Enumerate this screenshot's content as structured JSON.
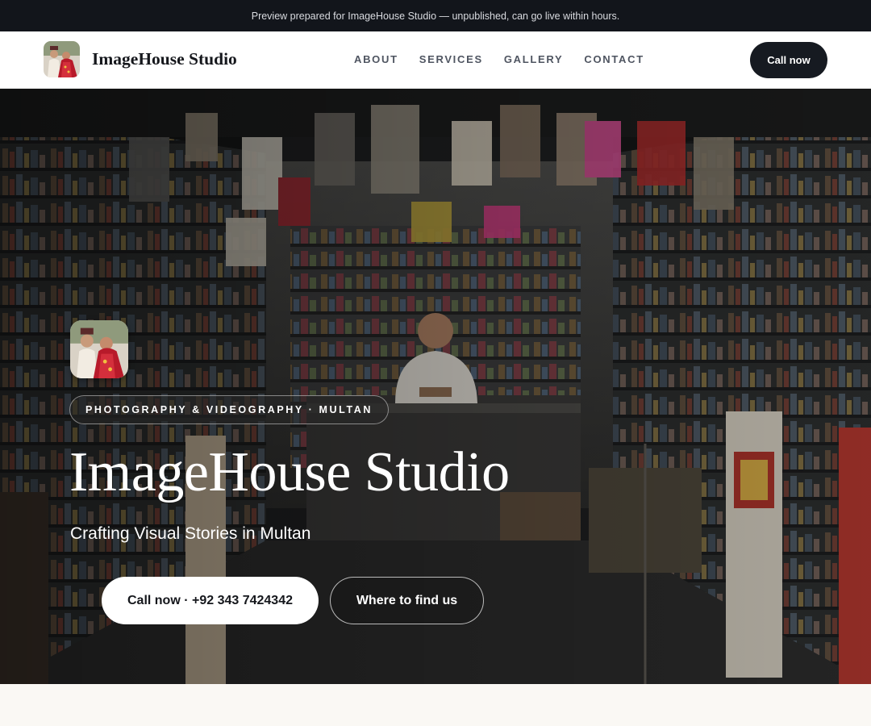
{
  "banner": {
    "text": "Preview prepared for ImageHouse Studio — unpublished, can go live within hours."
  },
  "nav": {
    "brand_name": "ImageHouse Studio",
    "logo_icon": "couple-photo-icon",
    "links": [
      "ABOUT",
      "SERVICES",
      "GALLERY",
      "CONTACT"
    ],
    "cta_label": "Call now"
  },
  "hero": {
    "background_icon": "shop-interior-photo",
    "logo_icon": "couple-photo-icon",
    "badge": "PHOTOGRAPHY & VIDEOGRAPHY · MULTAN",
    "title": "ImageHouse Studio",
    "subtitle": "Crafting Visual Stories in Multan",
    "primary_button": "Call now · +92 343 7424342",
    "secondary_button": "Where to find us"
  },
  "colors": {
    "banner_bg": "#12151b",
    "dark_button": "#161a21",
    "page_bg": "#faf8f4"
  }
}
